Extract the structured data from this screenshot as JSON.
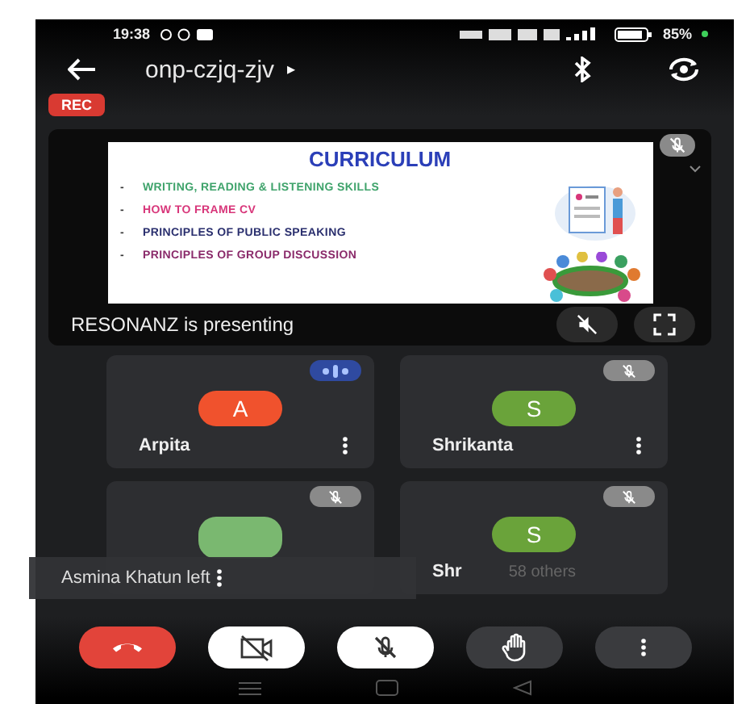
{
  "status_bar": {
    "time": "19:38",
    "battery": "85%"
  },
  "header": {
    "meeting_code": "onp-czjq-zjv",
    "caret": "▸"
  },
  "recording": {
    "label": "REC"
  },
  "presentation": {
    "slide": {
      "title": "CURRICULUM",
      "marker": "-",
      "bullets": [
        {
          "text": "WRITING, READING & LISTENING SKILLS",
          "color": "#3fa36b"
        },
        {
          "text": "HOW TO FRAME CV",
          "color": "#d8367a"
        },
        {
          "text": "PRINCIPLES OF PUBLIC SPEAKING",
          "color": "#2a2f6e"
        },
        {
          "text": "PRINCIPLES OF GROUP DISCUSSION",
          "color": "#8a2a6a"
        }
      ]
    },
    "caption": "RESONANZ is presenting",
    "muted": true
  },
  "tiles": [
    {
      "name": "Arpita",
      "avatar": "A",
      "color": "#f0522d",
      "kind": "letter",
      "muted": false
    },
    {
      "name": "Shrikanta",
      "avatar": "S",
      "color": "#6aa33a",
      "kind": "letter",
      "muted": true
    },
    {
      "kind": "photo",
      "muted": true
    },
    {
      "name": "Shr",
      "extra": "58 others",
      "avatar": "S",
      "color": "#6aa33a",
      "kind": "letter",
      "muted": true
    }
  ],
  "toast": {
    "text": "Asmina Khatun left"
  },
  "controls": [
    {
      "kind": "end_call"
    },
    {
      "kind": "camera_off"
    },
    {
      "kind": "mic_off"
    },
    {
      "kind": "raise_hand"
    },
    {
      "kind": "more"
    }
  ]
}
